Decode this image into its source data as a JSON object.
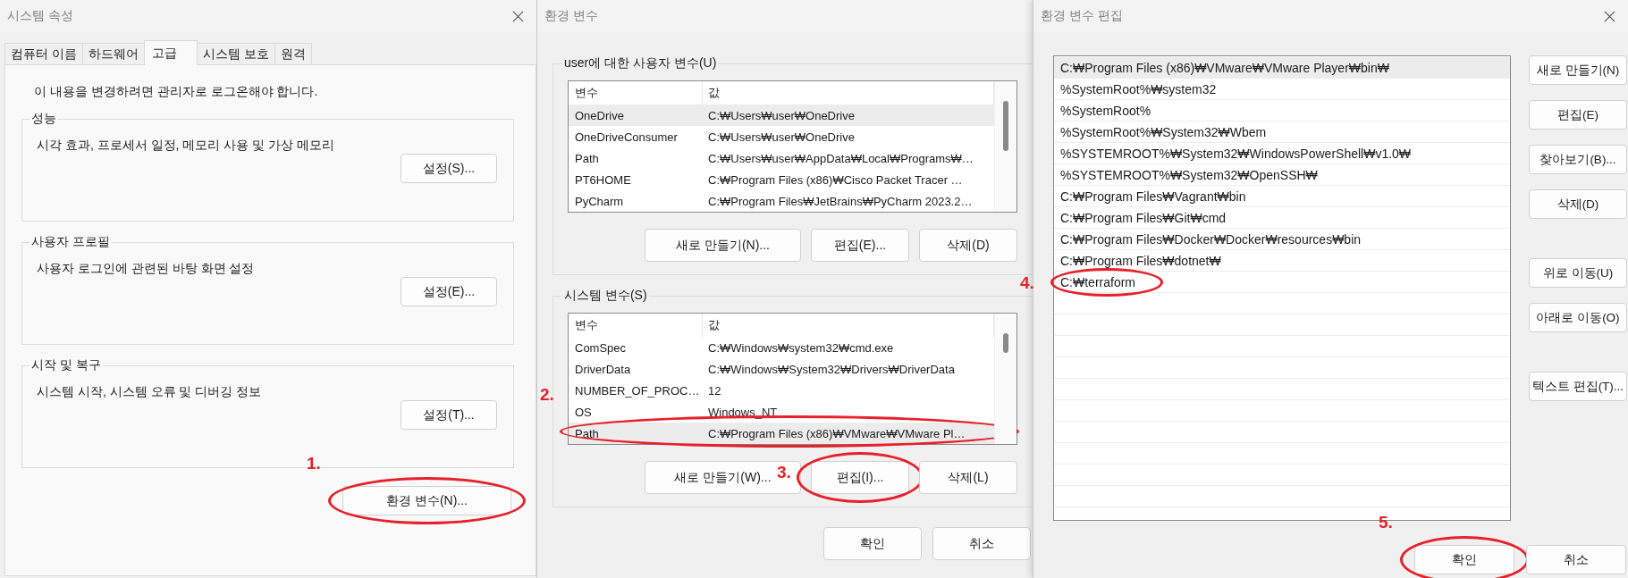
{
  "system_properties": {
    "title": "시스템 속성",
    "tabs": [
      {
        "label": "컴퓨터 이름",
        "selected": false
      },
      {
        "label": "하드웨어",
        "selected": false
      },
      {
        "label": "고급",
        "selected": true
      },
      {
        "label": "시스템 보호",
        "selected": false
      },
      {
        "label": "원격",
        "selected": false
      }
    ],
    "notice": "이 내용을 변경하려면 관리자로 로그온해야 합니다.",
    "groups": [
      {
        "title": "성능",
        "description": "시각 효과, 프로세서 일정, 메모리 사용 및 가상 메모리",
        "button": "설정(S)..."
      },
      {
        "title": "사용자 프로필",
        "description": "사용자 로그인에 관련된 바탕 화면 설정",
        "button": "설정(E)..."
      },
      {
        "title": "시작 및 복구",
        "description": "시스템 시작, 시스템 오류 및 디버깅 정보",
        "button": "설정(T)..."
      }
    ],
    "env_button": {
      "label": "환경 변수(N)...",
      "callout": {
        "label": "1.",
        "kind": "above"
      }
    }
  },
  "environment_variables": {
    "title": "환경 변수",
    "sections": [
      {
        "title": "user에 대한 사용자 변수(U)",
        "columns": [
          "변수",
          "값"
        ],
        "rows": [
          {
            "name": "OneDrive",
            "value": "C:₩Users₩user₩OneDrive",
            "selected": true
          },
          {
            "name": "OneDriveConsumer",
            "value": "C:₩Users₩user₩OneDrive",
            "selected": false
          },
          {
            "name": "Path",
            "value": "C:₩Users₩user₩AppData₩Local₩Programs₩…",
            "selected": false
          },
          {
            "name": "PT6HOME",
            "value": "C:₩Program Files (x86)₩Cisco Packet Tracer …",
            "selected": false
          },
          {
            "name": "PyCharm",
            "value": "C:₩Program Files₩JetBrains₩PyCharm 2023.2…",
            "selected": false
          }
        ],
        "buttons": [
          {
            "label": "새로 만들기(N)..."
          },
          {
            "label": "편집(E)..."
          },
          {
            "label": "삭제(D)"
          }
        ]
      },
      {
        "title": "시스템 변수(S)",
        "columns": [
          "변수",
          "값"
        ],
        "rows": [
          {
            "name": "ComSpec",
            "value": "C:₩Windows₩system32₩cmd.exe",
            "selected": false
          },
          {
            "name": "DriverData",
            "value": "C:₩Windows₩System32₩Drivers₩DriverData",
            "selected": false
          },
          {
            "name": "NUMBER_OF_PROC…",
            "value": "12",
            "selected": false
          },
          {
            "name": "OS",
            "value": "Windows_NT",
            "selected": false
          },
          {
            "name": "Path",
            "value": "C:₩Program Files (x86)₩VMware₩VMware Pl…",
            "selected": true,
            "callout": {
              "label": "2."
            }
          }
        ],
        "buttons": [
          {
            "label": "새로 만들기(W)..."
          },
          {
            "label": "편집(I)...",
            "callout": {
              "label": "3.",
              "kind": "beside"
            }
          },
          {
            "label": "삭제(L)"
          }
        ]
      }
    ],
    "buttons": [
      {
        "label": "확인"
      },
      {
        "label": "취소"
      }
    ]
  },
  "edit_environment_variable": {
    "title": "환경 변수 편집",
    "items": [
      {
        "text": "C:₩Program Files (x86)₩VMware₩VMware Player₩bin₩",
        "selected": true
      },
      {
        "text": "%SystemRoot%₩system32",
        "selected": false
      },
      {
        "text": "%SystemRoot%",
        "selected": false
      },
      {
        "text": "%SystemRoot%₩System32₩Wbem",
        "selected": false
      },
      {
        "text": "%SYSTEMROOT%₩System32₩WindowsPowerShell₩v1.0₩",
        "selected": false
      },
      {
        "text": "%SYSTEMROOT%₩System32₩OpenSSH₩",
        "selected": false
      },
      {
        "text": "C:₩Program Files₩Vagrant₩bin",
        "selected": false
      },
      {
        "text": "C:₩Program Files₩Git₩cmd",
        "selected": false
      },
      {
        "text": "C:₩Program Files₩Docker₩Docker₩resources₩bin",
        "selected": false
      },
      {
        "text": "C:₩Program Files₩dotnet₩",
        "selected": false
      },
      {
        "text": "C:₩terraform",
        "selected": false,
        "callout": {
          "label": "4."
        }
      }
    ],
    "button_groups": [
      [
        "새로 만들기(N)",
        "편집(E)",
        "찾아보기(B)...",
        "삭제(D)"
      ],
      [
        "위로 이동(U)",
        "아래로 이동(O)"
      ],
      [
        "텍스트 편집(T)..."
      ]
    ],
    "buttons": [
      {
        "label": "확인",
        "callout": {
          "label": "5.",
          "kind": "above"
        }
      },
      {
        "label": "취소"
      }
    ]
  }
}
